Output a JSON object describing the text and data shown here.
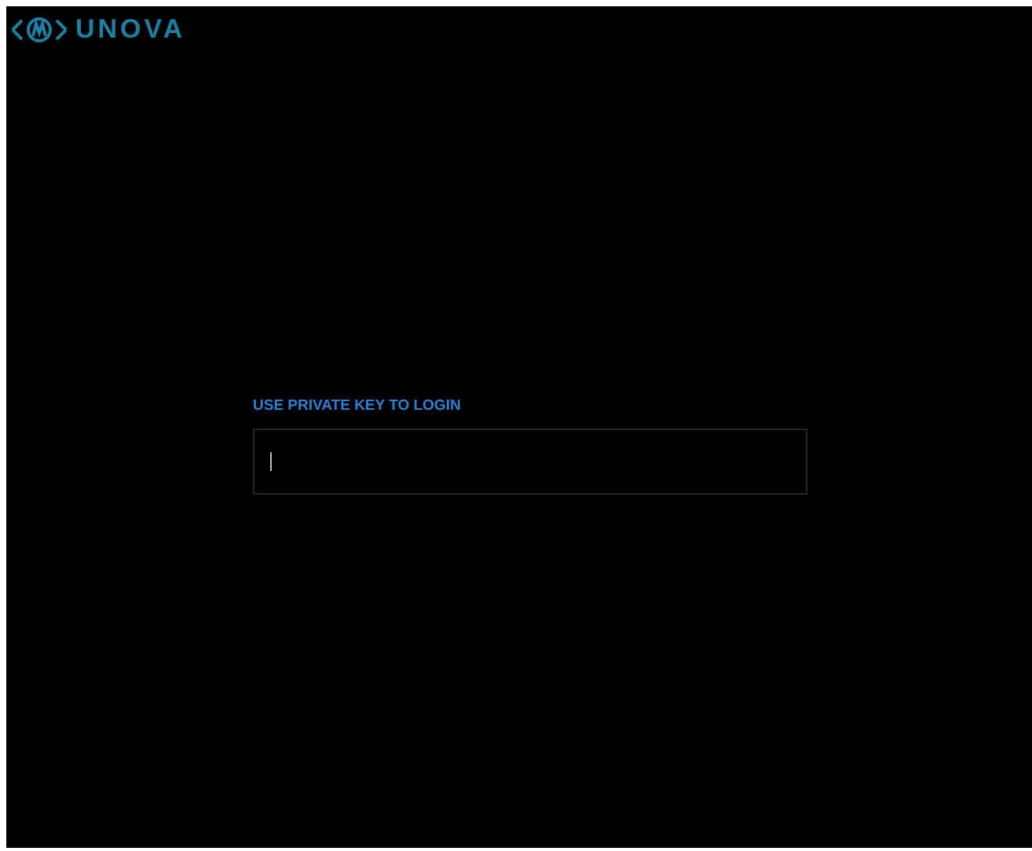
{
  "brand": {
    "name": "UNOVA"
  },
  "login": {
    "label": "USE PRIVATE KEY TO LOGIN"
  }
}
